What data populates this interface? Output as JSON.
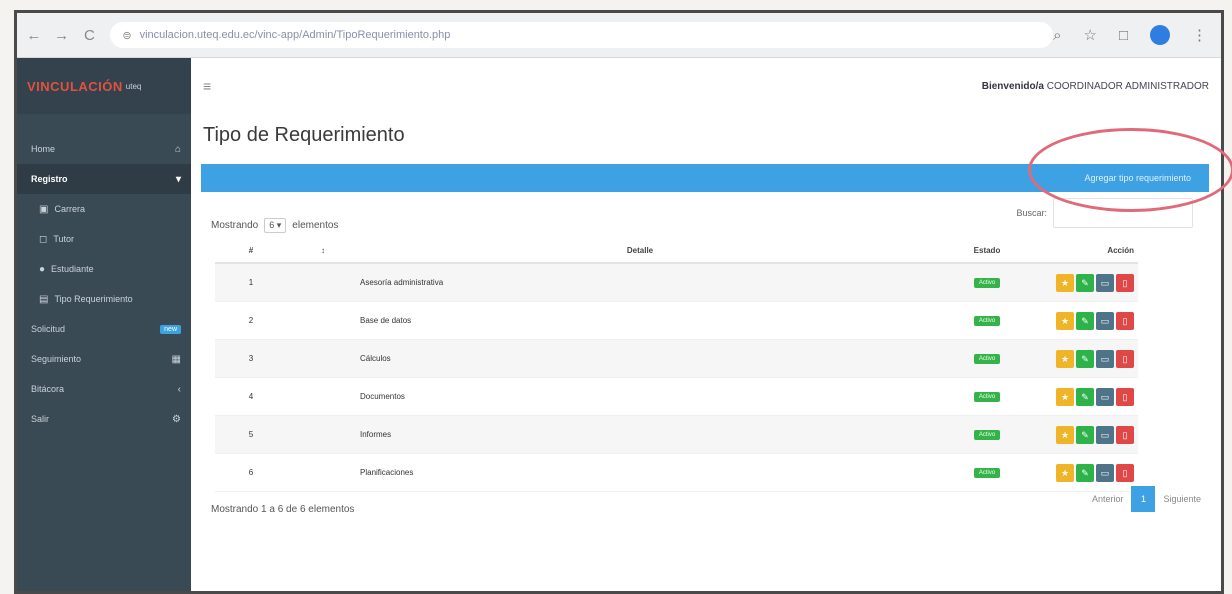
{
  "browser": {
    "url": "vinculacion.uteq.edu.ec/vinc-app/Admin/TipoRequerimiento.php",
    "back": "←",
    "forward": "→",
    "reload": "C"
  },
  "sidebar": {
    "brand_main": "VINCULACIÓN",
    "brand_sub": "uteq",
    "items": [
      {
        "label": "Home",
        "right": "⌂"
      },
      {
        "label": "Registro",
        "right": "▾"
      },
      {
        "label": "Carrera",
        "icon": "▣"
      },
      {
        "label": "Tutor",
        "icon": "◻"
      },
      {
        "label": "Estudiante",
        "icon": "●"
      },
      {
        "label": "Tipo Requerimiento",
        "icon": "▤"
      },
      {
        "label": "Solicitud",
        "badge": "new"
      },
      {
        "label": "Seguimiento",
        "right": "▦"
      },
      {
        "label": "Bitácora",
        "right": "‹"
      },
      {
        "label": "Salir",
        "right": "⚙"
      }
    ]
  },
  "header": {
    "menu_glyph": "≡",
    "welcome_prefix": "Bienvenido/a",
    "welcome_user": "COORDINADOR ADMINISTRADOR"
  },
  "main": {
    "title": "Tipo de Requerimiento",
    "add_button": "Agregar tipo requerimiento",
    "length_prefix": "Mostrando",
    "length_value": "6",
    "length_suffix": "elementos",
    "search_label": "Buscar:",
    "columns": {
      "index": "#",
      "name": "Detalle",
      "state": "Estado",
      "actions": "Acción"
    },
    "rows": [
      {
        "index": "1",
        "name": "Asesoría administrativa",
        "state": "Activo"
      },
      {
        "index": "2",
        "name": "Base de datos",
        "state": "Activo"
      },
      {
        "index": "3",
        "name": "Cálculos",
        "state": "Activo"
      },
      {
        "index": "4",
        "name": "Documentos",
        "state": "Activo"
      },
      {
        "index": "5",
        "name": "Informes",
        "state": "Activo"
      },
      {
        "index": "6",
        "name": "Planificaciones",
        "state": "Activo"
      }
    ],
    "info": "Mostrando 1 a 6 de 6 elementos",
    "pager": {
      "prev": "Anterior",
      "current": "1",
      "next": "Siguiente"
    }
  },
  "colors": {
    "sidebar": "#3a4a55",
    "accent_blue": "#3ea1e3",
    "status_green": "#35b34a",
    "annotation": "#e06a7a"
  }
}
